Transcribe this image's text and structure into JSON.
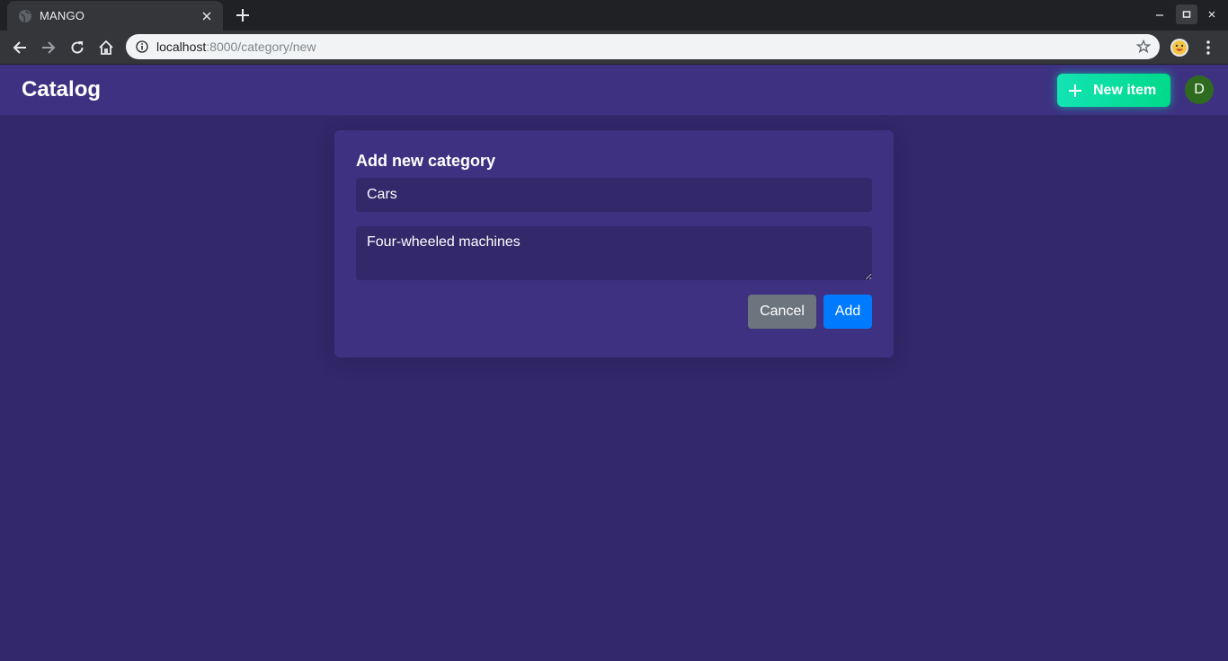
{
  "browser": {
    "tab_title": "MANGO",
    "url_host": "localhost",
    "url_path": ":8000/category/new",
    "icons": {
      "tab_favicon": "globe-icon",
      "tab_close": "close-icon",
      "new_tab": "plus-icon",
      "back": "arrow-left-icon",
      "forward": "arrow-right-icon",
      "reload": "reload-icon",
      "home": "home-icon",
      "site_info": "info-icon",
      "bookmark": "star-icon",
      "extension": "emoji-face-icon",
      "menu": "kebab-menu-icon",
      "minimize": "minimize-icon",
      "maximize": "maximize-icon",
      "close_window": "close-icon"
    }
  },
  "header": {
    "brand": "Catalog",
    "new_item_label": "New item",
    "avatar_initial": "D"
  },
  "form": {
    "title": "Add new category",
    "name_value": "Cars",
    "description_value": "Four-wheeled machines",
    "cancel_label": "Cancel",
    "add_label": "Add"
  },
  "colors": {
    "page_background": "#32286a",
    "header_background": "#3e3182",
    "card_background": "#3e3182",
    "new_item_button": "#00d98a",
    "cancel_button": "#6c757d",
    "add_button": "#007bff",
    "avatar": "#2e6b1f"
  }
}
